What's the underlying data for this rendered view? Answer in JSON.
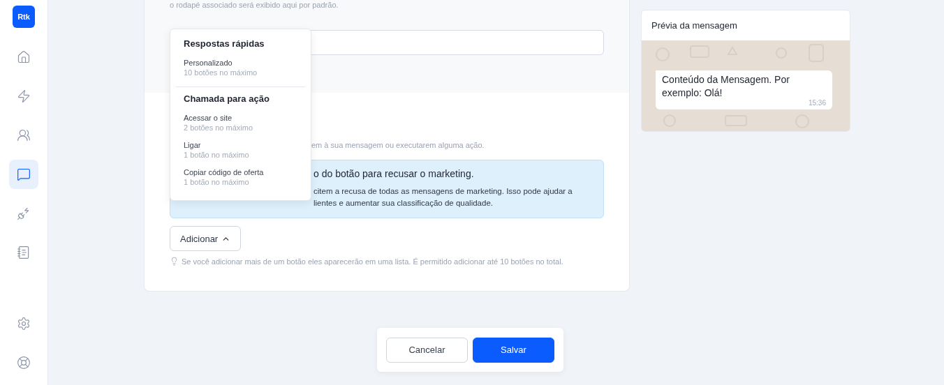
{
  "sidebar": {
    "logo": "Rtk",
    "items": [
      {
        "kind": "home",
        "selected": false
      },
      {
        "kind": "bolt",
        "selected": false
      },
      {
        "kind": "users",
        "selected": false
      },
      {
        "kind": "chat",
        "selected": true
      },
      {
        "kind": "plug",
        "selected": false
      },
      {
        "kind": "note",
        "selected": false
      }
    ],
    "bottom_items": [
      {
        "kind": "settings",
        "selected": false
      },
      {
        "kind": "help",
        "selected": false
      }
    ]
  },
  "form": {
    "footer_note": "o rodapé associado será exibido aqui por padrão.",
    "description": "em à sua mensagem ou executarem alguma ação.",
    "info": {
      "title": "o do botão para recusar o marketing.",
      "lines": [
        "citem a recusa de todas as mensagens de marketing. Isso pode ajudar a",
        "lientes e aumentar sua classificação de qualidade."
      ]
    },
    "add_button": {
      "label": "Adicionar",
      "expanded": true
    },
    "hint": "Se você adicionar mais de um botão eles aparecerão em uma lista. É permitido adicionar até 10 botões no total."
  },
  "dropdown": {
    "groups": [
      {
        "title": "Respostas rápidas",
        "options": [
          {
            "label": "Personalizado",
            "limit": "10 botões no máximo"
          }
        ]
      },
      {
        "title": "Chamada para ação",
        "options": [
          {
            "label": "Acessar o site",
            "limit": "2 botões no máximo"
          },
          {
            "label": "Ligar",
            "limit": "1 botão no máximo"
          },
          {
            "label": "Copiar código de oferta",
            "limit": "1 botão no máximo"
          }
        ]
      }
    ]
  },
  "actions": [
    {
      "label": "Cancelar",
      "kind": "secondary"
    },
    {
      "label": "Salvar",
      "kind": "primary"
    }
  ],
  "preview": {
    "title": "Prévia da mensagem",
    "message": "Conteúdo da Mensagem. Por exemplo: Olá!",
    "time": "15:36"
  }
}
